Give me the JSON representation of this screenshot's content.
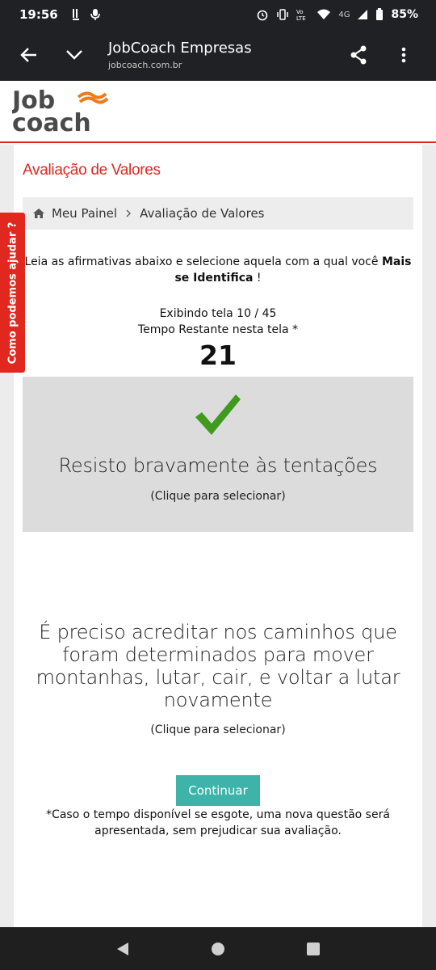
{
  "status_bar": {
    "time": "19:56",
    "battery": "85%",
    "network": "4G"
  },
  "browser": {
    "title": "JobCoach Empresas",
    "url": "jobcoach.com.br"
  },
  "logo": {
    "line1": "Job",
    "line2": "coach"
  },
  "page": {
    "title": "Avaliação de Valores",
    "breadcrumb": {
      "home": "Meu Painel",
      "current": "Avaliação de Valores"
    },
    "instructions_prefix": "Leia as afirmativas abaixo e selecione aquela com a qual você ",
    "instructions_bold": "Mais se Identifica",
    "instructions_suffix": " !",
    "screen_counter": "Exibindo tela 10 / 45",
    "time_remaining_label": "Tempo Restante nesta tela *",
    "countdown": "21"
  },
  "options": [
    {
      "text": "Resisto bravamente às tentações",
      "hint": "(Clique para selecionar)",
      "selected": true
    },
    {
      "text": "É preciso acreditar nos caminhos que foram determinados para mover montanhas, lutar, cair, e voltar a lutar novamente",
      "hint": "(Clique para selecionar)",
      "selected": false
    }
  ],
  "continue_label": "Continuar",
  "footnote": "*Caso o tempo disponível se esgote, uma nova questão será apresentada, sem prejudicar sua avaliação.",
  "help_tab": "Como podemos ajudar ?",
  "colors": {
    "brand_red": "#e0281f",
    "button_teal": "#3eb3a9",
    "check_green": "#3f9a1e",
    "logo_orange": "#ef7a1a"
  }
}
